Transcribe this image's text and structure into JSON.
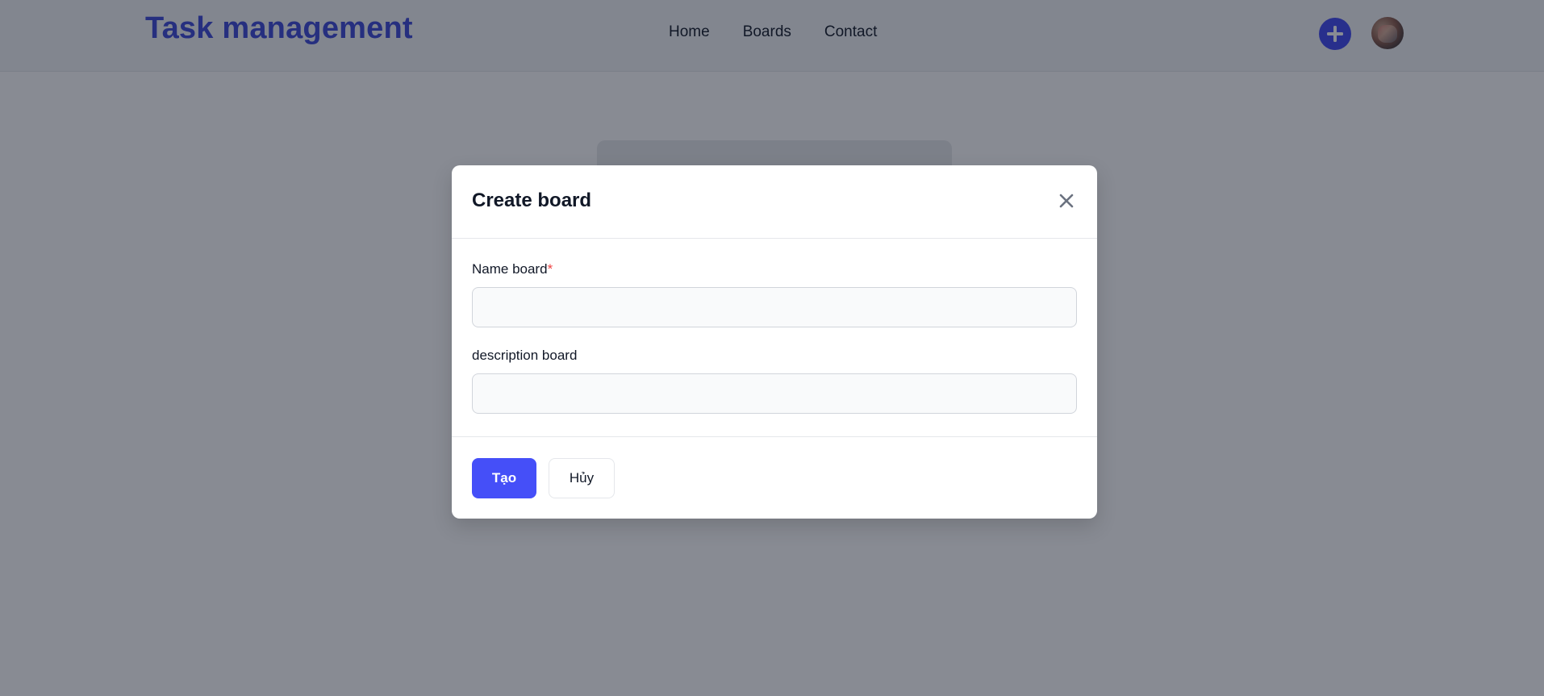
{
  "header": {
    "logo": "Task management",
    "nav": [
      {
        "label": "Home"
      },
      {
        "label": "Boards"
      },
      {
        "label": "Contact"
      }
    ],
    "add_icon": "plus-icon",
    "avatar_icon": "user-avatar"
  },
  "modal": {
    "title": "Create board",
    "close_icon": "close-icon",
    "fields": [
      {
        "label": "Name board",
        "required_mark": "*",
        "value": "",
        "placeholder": ""
      },
      {
        "label": "description board",
        "value": "",
        "placeholder": ""
      }
    ],
    "buttons": {
      "create_label": "Tạo",
      "cancel_label": "Hủy"
    }
  },
  "colors": {
    "accent": "#454ff8",
    "logo": "#3b47d6",
    "required": "#ef4444"
  }
}
